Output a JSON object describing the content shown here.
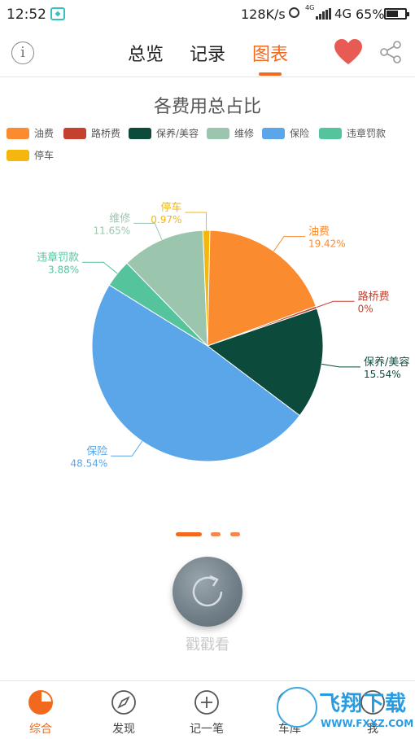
{
  "status_bar": {
    "time": "12:52",
    "net_speed": "128K/s",
    "network_small": "4G",
    "network": "4G",
    "battery": "65%",
    "battery_level": 0.65
  },
  "header": {
    "info_icon": "i",
    "tabs": [
      "总览",
      "记录",
      "图表"
    ],
    "active_tab": 2,
    "heart_color": "#e85b55"
  },
  "chart_data": {
    "type": "pie",
    "title": "各费用总占比",
    "legend_placement": "top",
    "slices": [
      {
        "name": "油费",
        "value": 19.42,
        "label": "19.42%",
        "color": "#fa8b2f"
      },
      {
        "name": "路桥费",
        "value": 0.0,
        "label": "0%",
        "color": "#c5402f"
      },
      {
        "name": "保养/美容",
        "value": 15.54,
        "label": "15.54%",
        "color": "#0c4a3c"
      },
      {
        "name": "保险",
        "value": 48.54,
        "label": "48.54%",
        "color": "#5aa6e8"
      },
      {
        "name": "违章罚款",
        "value": 3.88,
        "label": "3.88%",
        "color": "#55c49c"
      },
      {
        "name": "维修",
        "value": 11.65,
        "label": "11.65%",
        "color": "#9cc5ae"
      },
      {
        "name": "停车",
        "value": 0.97,
        "label": "0.97%",
        "color": "#f5b60d"
      }
    ],
    "legend_order": [
      "油费",
      "路桥费",
      "保养/美容",
      "维修",
      "保险",
      "违章罚款",
      "停车"
    ]
  },
  "pager": {
    "pages": 3,
    "current": 0
  },
  "shake": {
    "label": "戳戳看"
  },
  "bottom_nav": [
    {
      "label": "综合",
      "icon": "pie-chart-icon",
      "active": true
    },
    {
      "label": "发现",
      "icon": "compass-icon",
      "active": false
    },
    {
      "label": "记一笔",
      "icon": "plus-circle-icon",
      "active": false
    },
    {
      "label": "车库",
      "icon": "garage-icon",
      "active": false
    },
    {
      "label": "我",
      "icon": "user-icon",
      "active": false
    }
  ],
  "watermark": {
    "text": "飞翔下载",
    "url": "WWW.FXXZ.COM"
  }
}
